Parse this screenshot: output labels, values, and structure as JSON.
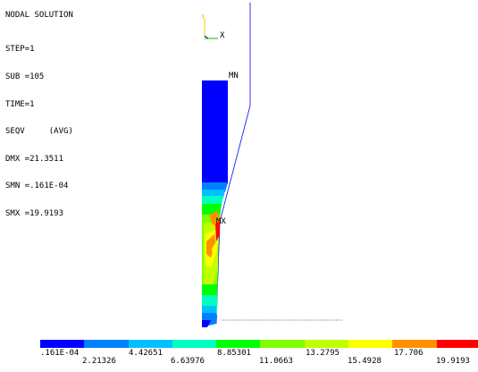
{
  "header": {
    "title": "NODAL SOLUTION",
    "lines": [
      "STEP=1",
      "SUB =105",
      "TIME=1",
      "SEQV     (AVG)",
      "DMX =21.3511",
      "SMN =.161E-04",
      "SMX =19.9193"
    ]
  },
  "triad": {
    "y_label": "Y",
    "x_label": "X"
  },
  "markers": {
    "min_label": "MN",
    "max_label": "MX"
  },
  "legend": {
    "colors": [
      "#0000ff",
      "#0080ff",
      "#00c0ff",
      "#00ffc0",
      "#00ff00",
      "#80ff00",
      "#c0ff00",
      "#ffff00",
      "#ff9000",
      "#ff0000"
    ],
    "top_labels": [
      ".161E-04",
      "4.42651",
      "8.85301",
      "13.2795",
      "17.706"
    ],
    "bottom_labels": [
      "2.21326",
      "6.63976",
      "11.0663",
      "15.4928",
      "19.9193"
    ]
  }
}
